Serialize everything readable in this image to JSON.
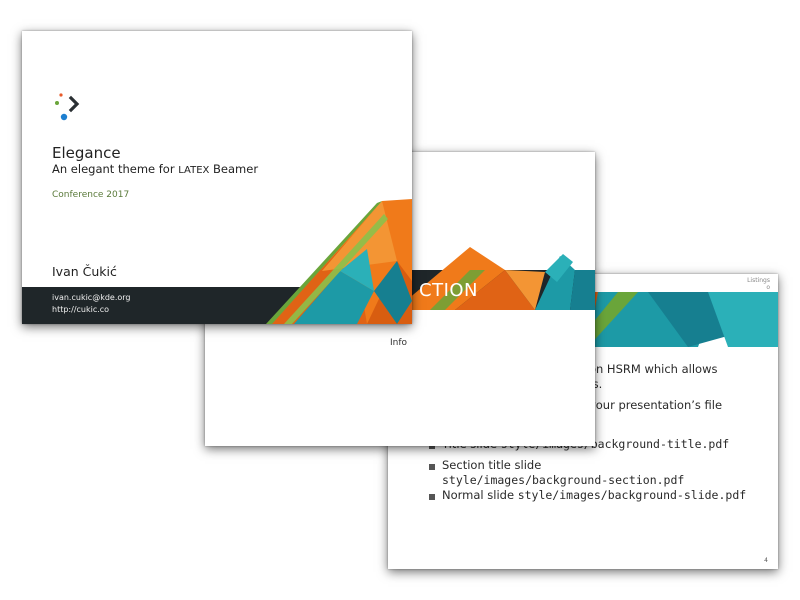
{
  "slides": {
    "title_slide": {
      "title": "Elegance",
      "subtitle": "An elegant theme for LATEX Beamer",
      "subtitle_prefix": "An elegant theme for ",
      "subtitle_suffix": " Beamer",
      "latex_logo": "LATEX",
      "conference": "Conference 2017",
      "author": "Ivan Čukić",
      "email": "ivan.cukic@kde.org",
      "url": "http://cukic.co"
    },
    "section_slide": {
      "section_title_visible": "CTION",
      "info_text": "Info"
    },
    "content_slide": {
      "listings_label": "Listings",
      "listings_sub": "o",
      "text_line_1": "d on HSRM which allows",
      "text_line_2": "nds.",
      "text_line_3": "n your presentation’s file",
      "item_1_label": "Title slide ",
      "item_1_path": "style/images/background-title.pdf",
      "item_2_label": "Section title slide",
      "item_2_path": "style/images/background-section.pdf",
      "item_3_label": "Normal slide ",
      "item_3_path": "style/images/background-slide.pdf",
      "page_number": "4"
    }
  },
  "colors": {
    "orange": "#f07a1a",
    "orange_dark": "#d85d10",
    "teal": "#1d9aa6",
    "teal_dark": "#167f90",
    "green": "#6aa53a",
    "dark_band": "#1f2629"
  }
}
